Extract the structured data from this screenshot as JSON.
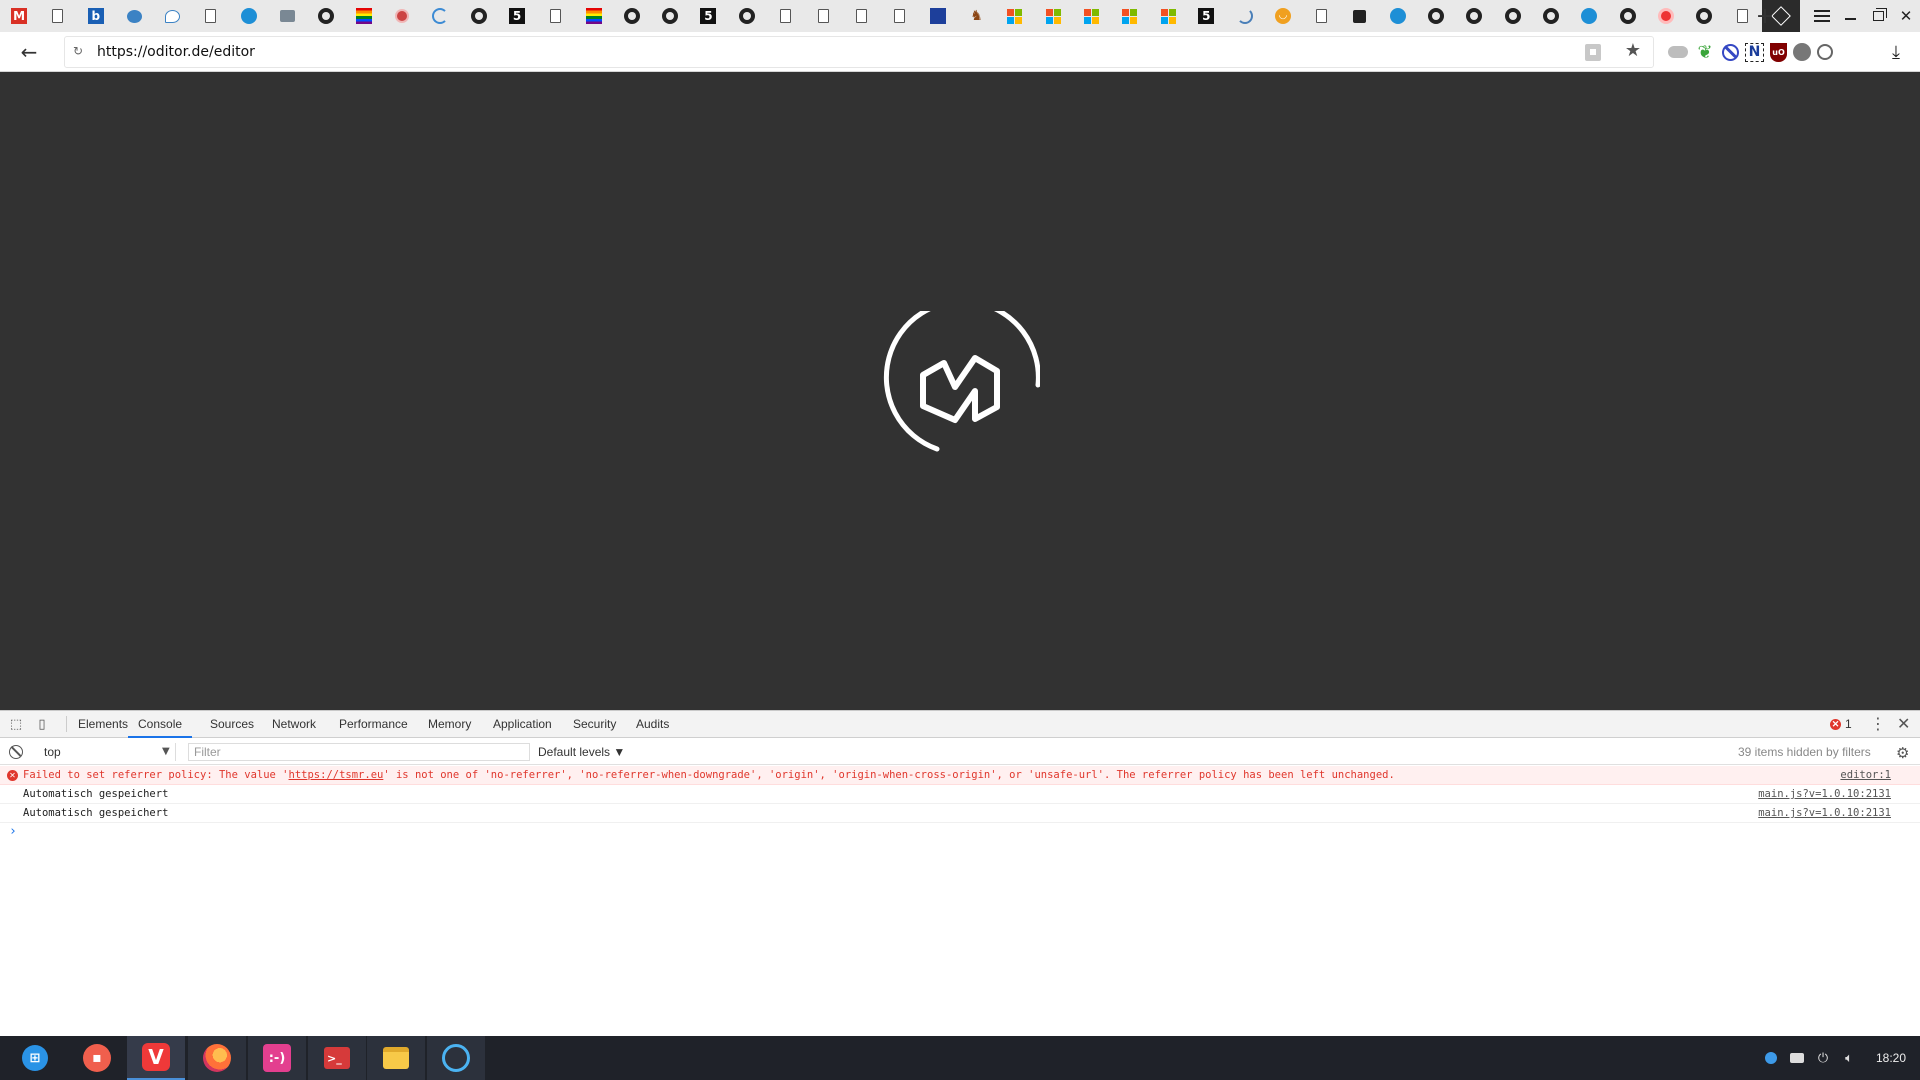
{
  "browser": {
    "url": "https://oditor.de/editor",
    "tab_count": 45
  },
  "devtools": {
    "tabs": [
      "Elements",
      "Console",
      "Sources",
      "Network",
      "Performance",
      "Memory",
      "Application",
      "Security",
      "Audits"
    ],
    "active_tab": "Console",
    "error_count": "1",
    "context": "top",
    "filter_placeholder": "Filter",
    "levels": "Default levels",
    "hidden_text": "39 items hidden by filters",
    "messages": [
      {
        "level": "error",
        "prefix": "Failed to set referrer policy: The value '",
        "link": "https://tsmr.eu",
        "suffix": "' is not one of 'no-referrer', 'no-referrer-when-downgrade', 'origin', 'origin-when-cross-origin', or 'unsafe-url'. The referrer policy has been left unchanged.",
        "source": "editor:1"
      },
      {
        "level": "info",
        "text": "Automatisch gespeichert",
        "source": "main.js?v=1.0.10:2131"
      },
      {
        "level": "info",
        "text": "Automatisch gespeichert",
        "source": "main.js?v=1.0.10:2131"
      }
    ]
  },
  "taskbar": {
    "clock": "18:20"
  },
  "colors": {
    "page_background": "#323232",
    "accent_blue": "#1a73e8",
    "error_red": "#e0372d",
    "taskbar": "#1f2229"
  }
}
